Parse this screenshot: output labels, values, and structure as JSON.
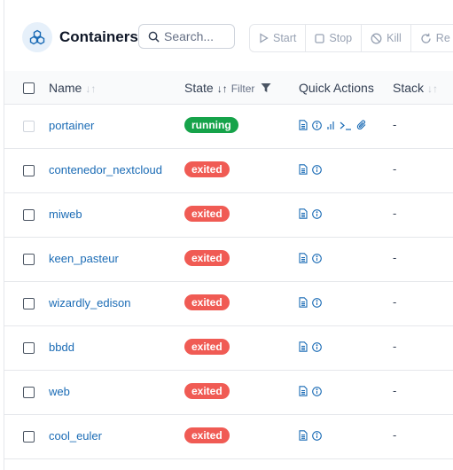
{
  "header": {
    "title": "Containers",
    "search_placeholder": "Search...",
    "buttons": {
      "start": "Start",
      "stop": "Stop",
      "kill": "Kill",
      "restart": "Re"
    }
  },
  "columns": {
    "name": "Name",
    "state": "State",
    "filter": "Filter",
    "quick_actions": "Quick Actions",
    "stack": "Stack"
  },
  "rows": [
    {
      "name": "portainer",
      "state": "running",
      "stack": "-"
    },
    {
      "name": "contenedor_nextcloud",
      "state": "exited",
      "stack": "-"
    },
    {
      "name": "miweb",
      "state": "exited",
      "stack": "-"
    },
    {
      "name": "keen_pasteur",
      "state": "exited",
      "stack": "-"
    },
    {
      "name": "wizardly_edison",
      "state": "exited",
      "stack": "-"
    },
    {
      "name": "bbdd",
      "state": "exited",
      "stack": "-"
    },
    {
      "name": "web",
      "state": "exited",
      "stack": "-"
    },
    {
      "name": "cool_euler",
      "state": "exited",
      "stack": "-"
    }
  ],
  "colors": {
    "link": "#1a6bb5",
    "running": "#16a34a",
    "exited": "#f05b54"
  }
}
